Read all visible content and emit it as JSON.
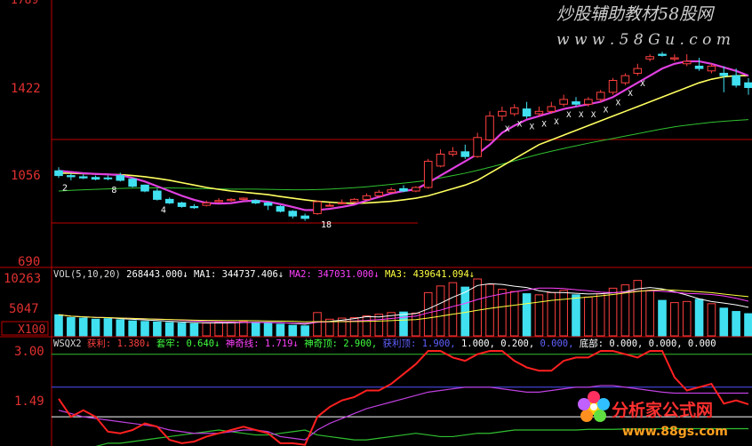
{
  "watermark_top": {
    "title": "炒股辅助教材58股网",
    "url": "w w w . 5 8 G u . c o m"
  },
  "watermark_bottom": {
    "title": "分析家公式网",
    "url": "www.88gs.com"
  },
  "price_panel": {
    "y_ticks": [
      "1422",
      "1056",
      "690"
    ],
    "top_tick_partial": "1789",
    "marker_labels": [
      "2",
      "8",
      "4",
      "18"
    ],
    "sell_marker_text": "X"
  },
  "volume_panel": {
    "header": [
      {
        "text": "VOL(5,10,20)",
        "color": "#d8d8d8"
      },
      {
        "text": "268443.000↓",
        "color": "#ffffff"
      },
      {
        "text": "MA1: 344737.406↓",
        "color": "#ffffff"
      },
      {
        "text": "MA2: 347031.000↓",
        "color": "#ff40ff"
      },
      {
        "text": "MA3: 439641.094↓",
        "color": "#ffff40"
      }
    ],
    "y_ticks": [
      "10263",
      "5047"
    ],
    "unit_label": "X100"
  },
  "indicator_panel": {
    "header": [
      {
        "text": "WSQX2",
        "color": "#d8d8d8"
      },
      {
        "text": "获利: 1.380↓",
        "color": "#ff4040"
      },
      {
        "text": "套牢: 0.640↓",
        "color": "#40ff40"
      },
      {
        "text": "神奇线: 1.719↓",
        "color": "#ff40ff"
      },
      {
        "text": "神奇顶: 2.900,",
        "color": "#40ff40"
      },
      {
        "text": "获利顶: 1.900,",
        "color": "#6060ff"
      },
      {
        "text": "1.000,",
        "color": "#ffffff"
      },
      {
        "text": "0.200,",
        "color": "#ffffff"
      },
      {
        "text": "0.000,",
        "color": "#6060ff"
      },
      {
        "text": "底部: 0.000,",
        "color": "#ffffff"
      },
      {
        "text": "0.000,",
        "color": "#ffffff"
      },
      {
        "text": "0.000",
        "color": "#ffffff"
      }
    ],
    "y_ticks": [
      "3.00",
      "1.49"
    ]
  },
  "chart_data": {
    "type": "candlestick",
    "price_ylim": [
      690,
      1789
    ],
    "volume_ylim": [
      0,
      12000
    ],
    "indicator_ylim": [
      0,
      3.3
    ],
    "candles": [
      [
        1070,
        1085,
        1050,
        1040
      ],
      [
        1050,
        1058,
        1045,
        1030
      ],
      [
        1045,
        1055,
        1040,
        1035
      ],
      [
        1042,
        1050,
        1035,
        1030
      ],
      [
        1040,
        1050,
        1038,
        1030
      ],
      [
        1050,
        1062,
        1030,
        1025
      ],
      [
        1035,
        1040,
        1005,
        1000
      ],
      [
        1010,
        1012,
        985,
        980
      ],
      [
        985,
        995,
        950,
        945
      ],
      [
        950,
        958,
        935,
        930
      ],
      [
        935,
        940,
        920,
        915
      ],
      [
        920,
        930,
        915,
        910
      ],
      [
        925,
        945,
        935,
        920
      ],
      [
        940,
        955,
        945,
        935
      ],
      [
        945,
        955,
        950,
        940
      ],
      [
        950,
        958,
        955,
        945
      ],
      [
        945,
        950,
        935,
        930
      ],
      [
        935,
        940,
        925,
        905
      ],
      [
        920,
        925,
        900,
        895
      ],
      [
        900,
        905,
        880,
        870
      ],
      [
        880,
        890,
        870,
        860
      ],
      [
        890,
        945,
        940,
        885
      ],
      [
        925,
        935,
        925,
        920
      ],
      [
        935,
        950,
        935,
        930
      ],
      [
        940,
        955,
        950,
        935
      ],
      [
        950,
        975,
        965,
        945
      ],
      [
        965,
        990,
        980,
        960
      ],
      [
        980,
        1000,
        990,
        975
      ],
      [
        995,
        1010,
        985,
        980
      ],
      [
        985,
        1005,
        1000,
        980
      ],
      [
        1000,
        1120,
        1110,
        995
      ],
      [
        1090,
        1160,
        1140,
        1085
      ],
      [
        1140,
        1170,
        1150,
        1130
      ],
      [
        1150,
        1180,
        1130,
        1120
      ],
      [
        1130,
        1230,
        1210,
        1125
      ],
      [
        1200,
        1320,
        1300,
        1195
      ],
      [
        1300,
        1340,
        1320,
        1280
      ],
      [
        1310,
        1350,
        1335,
        1300
      ],
      [
        1330,
        1360,
        1300,
        1290
      ],
      [
        1310,
        1340,
        1320,
        1300
      ],
      [
        1320,
        1360,
        1340,
        1310
      ],
      [
        1350,
        1390,
        1370,
        1340
      ],
      [
        1360,
        1380,
        1350,
        1340
      ],
      [
        1350,
        1380,
        1370,
        1340
      ],
      [
        1370,
        1410,
        1400,
        1360
      ],
      [
        1400,
        1460,
        1450,
        1390
      ],
      [
        1440,
        1480,
        1470,
        1430
      ],
      [
        1480,
        1520,
        1500,
        1470
      ],
      [
        1540,
        1560,
        1550,
        1530
      ],
      [
        1560,
        1570,
        1555,
        1550
      ],
      [
        1540,
        1560,
        1545,
        1530
      ],
      [
        1520,
        1560,
        1530,
        1510
      ],
      [
        1510,
        1545,
        1500,
        1490
      ],
      [
        1490,
        1520,
        1510,
        1480
      ],
      [
        1480,
        1510,
        1470,
        1400
      ],
      [
        1470,
        1500,
        1430,
        1420
      ],
      [
        1440,
        1460,
        1420,
        1390
      ]
    ],
    "volume": [
      3800,
      3300,
      3200,
      3000,
      3100,
      2900,
      2700,
      2600,
      2500,
      2400,
      2300,
      2200,
      2300,
      2400,
      2500,
      2600,
      2400,
      2300,
      2100,
      1900,
      1800,
      4200,
      3000,
      3200,
      3300,
      3600,
      3900,
      4200,
      4300,
      4100,
      7800,
      9000,
      9600,
      8800,
      10263,
      9300,
      8400,
      8000,
      7600,
      7400,
      7800,
      8200,
      7400,
      7000,
      7600,
      8600,
      9200,
      10000,
      8200,
      6400,
      6000,
      6200,
      6600,
      5800,
      5000,
      4400,
      4000
    ],
    "ma5": [
      1070,
      1065,
      1060,
      1057,
      1055,
      1052,
      1040,
      1025,
      1005,
      985,
      965,
      948,
      935,
      932,
      934,
      942,
      945,
      940,
      930,
      918,
      905,
      905,
      910,
      918,
      928,
      945,
      960,
      975,
      985,
      992,
      1020,
      1050,
      1080,
      1110,
      1140,
      1180,
      1230,
      1260,
      1285,
      1300,
      1315,
      1330,
      1340,
      1350,
      1360,
      1380,
      1410,
      1440,
      1470,
      1500,
      1520,
      1530,
      1530,
      1520,
      1505,
      1490,
      1470
    ],
    "ma10": [
      1060,
      1060,
      1058,
      1056,
      1055,
      1054,
      1050,
      1045,
      1038,
      1030,
      1020,
      1010,
      1000,
      992,
      985,
      980,
      975,
      970,
      962,
      955,
      948,
      942,
      938,
      935,
      933,
      935,
      938,
      942,
      948,
      955,
      965,
      980,
      995,
      1010,
      1030,
      1060,
      1090,
      1120,
      1150,
      1180,
      1200,
      1220,
      1240,
      1260,
      1280,
      1300,
      1320,
      1340,
      1360,
      1380,
      1400,
      1420,
      1440,
      1455,
      1465,
      1470,
      1470
    ],
    "ma20": [
      985,
      988,
      990,
      992,
      994,
      996,
      997,
      998,
      998,
      998,
      997,
      996,
      995,
      994,
      993,
      993,
      993,
      992,
      991,
      990,
      990,
      991,
      993,
      996,
      999,
      1003,
      1008,
      1013,
      1018,
      1024,
      1030,
      1040,
      1050,
      1060,
      1072,
      1085,
      1098,
      1112,
      1126,
      1140,
      1152,
      1164,
      1175,
      1186,
      1196,
      1206,
      1216,
      1226,
      1236,
      1246,
      1255,
      1262,
      1268,
      1274,
      1278,
      1282,
      1285
    ],
    "wsqx_profit": [
      1.55,
      1.0,
      1.2,
      1.0,
      0.55,
      0.5,
      0.6,
      0.8,
      0.7,
      0.3,
      0.2,
      0.25,
      0.4,
      0.5,
      0.6,
      0.7,
      0.6,
      0.5,
      0.2,
      0.2,
      0.15,
      1.0,
      1.3,
      1.5,
      1.6,
      1.8,
      1.8,
      2.0,
      2.3,
      2.6,
      3.0,
      3.0,
      2.8,
      2.7,
      2.9,
      3.0,
      3.0,
      2.7,
      2.5,
      2.4,
      2.4,
      2.7,
      2.8,
      2.8,
      3.0,
      3.0,
      2.9,
      2.8,
      3.0,
      3.0,
      2.2,
      1.8,
      1.9,
      2.0,
      1.4,
      1.5,
      1.38
    ],
    "wsqx_line": [
      1.2,
      1.1,
      1.0,
      0.95,
      0.9,
      0.85,
      0.8,
      0.75,
      0.7,
      0.6,
      0.55,
      0.5,
      0.5,
      0.5,
      0.55,
      0.6,
      0.6,
      0.55,
      0.4,
      0.35,
      0.3,
      0.6,
      0.8,
      0.95,
      1.1,
      1.25,
      1.35,
      1.45,
      1.55,
      1.65,
      1.75,
      1.8,
      1.85,
      1.9,
      1.9,
      1.9,
      1.85,
      1.8,
      1.75,
      1.75,
      1.8,
      1.85,
      1.9,
      1.9,
      1.95,
      1.95,
      1.9,
      1.85,
      1.8,
      1.75,
      1.72,
      1.72,
      1.72,
      1.72,
      1.72,
      1.72,
      1.72
    ],
    "wsqx_trapped": [
      0.1,
      0.0,
      0.0,
      0.1,
      0.2,
      0.2,
      0.25,
      0.3,
      0.35,
      0.4,
      0.45,
      0.5,
      0.55,
      0.6,
      0.55,
      0.5,
      0.45,
      0.45,
      0.5,
      0.55,
      0.6,
      0.45,
      0.4,
      0.35,
      0.3,
      0.3,
      0.35,
      0.4,
      0.45,
      0.5,
      0.45,
      0.4,
      0.4,
      0.45,
      0.5,
      0.5,
      0.55,
      0.6,
      0.6,
      0.6,
      0.6,
      0.6,
      0.6,
      0.62,
      0.62,
      0.62,
      0.63,
      0.63,
      0.63,
      0.64,
      0.64,
      0.64,
      0.64,
      0.64,
      0.64,
      0.64,
      0.64
    ],
    "wsqx_ref_levels": {
      "top": 2.9,
      "profit_top": 1.9,
      "white": 1.0
    }
  }
}
